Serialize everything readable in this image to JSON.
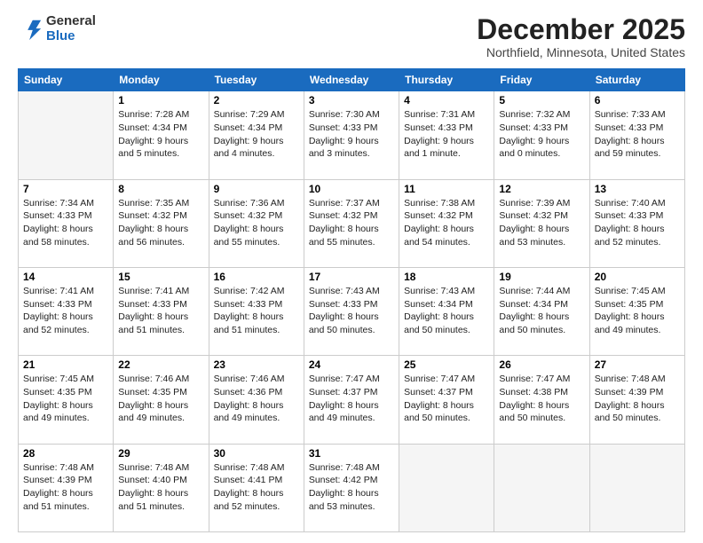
{
  "logo": {
    "line1": "General",
    "line2": "Blue"
  },
  "title": "December 2025",
  "location": "Northfield, Minnesota, United States",
  "days_header": [
    "Sunday",
    "Monday",
    "Tuesday",
    "Wednesday",
    "Thursday",
    "Friday",
    "Saturday"
  ],
  "weeks": [
    [
      {
        "num": "",
        "info": ""
      },
      {
        "num": "1",
        "info": "Sunrise: 7:28 AM\nSunset: 4:34 PM\nDaylight: 9 hours\nand 5 minutes."
      },
      {
        "num": "2",
        "info": "Sunrise: 7:29 AM\nSunset: 4:34 PM\nDaylight: 9 hours\nand 4 minutes."
      },
      {
        "num": "3",
        "info": "Sunrise: 7:30 AM\nSunset: 4:33 PM\nDaylight: 9 hours\nand 3 minutes."
      },
      {
        "num": "4",
        "info": "Sunrise: 7:31 AM\nSunset: 4:33 PM\nDaylight: 9 hours\nand 1 minute."
      },
      {
        "num": "5",
        "info": "Sunrise: 7:32 AM\nSunset: 4:33 PM\nDaylight: 9 hours\nand 0 minutes."
      },
      {
        "num": "6",
        "info": "Sunrise: 7:33 AM\nSunset: 4:33 PM\nDaylight: 8 hours\nand 59 minutes."
      }
    ],
    [
      {
        "num": "7",
        "info": "Sunrise: 7:34 AM\nSunset: 4:33 PM\nDaylight: 8 hours\nand 58 minutes."
      },
      {
        "num": "8",
        "info": "Sunrise: 7:35 AM\nSunset: 4:32 PM\nDaylight: 8 hours\nand 56 minutes."
      },
      {
        "num": "9",
        "info": "Sunrise: 7:36 AM\nSunset: 4:32 PM\nDaylight: 8 hours\nand 55 minutes."
      },
      {
        "num": "10",
        "info": "Sunrise: 7:37 AM\nSunset: 4:32 PM\nDaylight: 8 hours\nand 55 minutes."
      },
      {
        "num": "11",
        "info": "Sunrise: 7:38 AM\nSunset: 4:32 PM\nDaylight: 8 hours\nand 54 minutes."
      },
      {
        "num": "12",
        "info": "Sunrise: 7:39 AM\nSunset: 4:32 PM\nDaylight: 8 hours\nand 53 minutes."
      },
      {
        "num": "13",
        "info": "Sunrise: 7:40 AM\nSunset: 4:33 PM\nDaylight: 8 hours\nand 52 minutes."
      }
    ],
    [
      {
        "num": "14",
        "info": "Sunrise: 7:41 AM\nSunset: 4:33 PM\nDaylight: 8 hours\nand 52 minutes."
      },
      {
        "num": "15",
        "info": "Sunrise: 7:41 AM\nSunset: 4:33 PM\nDaylight: 8 hours\nand 51 minutes."
      },
      {
        "num": "16",
        "info": "Sunrise: 7:42 AM\nSunset: 4:33 PM\nDaylight: 8 hours\nand 51 minutes."
      },
      {
        "num": "17",
        "info": "Sunrise: 7:43 AM\nSunset: 4:33 PM\nDaylight: 8 hours\nand 50 minutes."
      },
      {
        "num": "18",
        "info": "Sunrise: 7:43 AM\nSunset: 4:34 PM\nDaylight: 8 hours\nand 50 minutes."
      },
      {
        "num": "19",
        "info": "Sunrise: 7:44 AM\nSunset: 4:34 PM\nDaylight: 8 hours\nand 50 minutes."
      },
      {
        "num": "20",
        "info": "Sunrise: 7:45 AM\nSunset: 4:35 PM\nDaylight: 8 hours\nand 49 minutes."
      }
    ],
    [
      {
        "num": "21",
        "info": "Sunrise: 7:45 AM\nSunset: 4:35 PM\nDaylight: 8 hours\nand 49 minutes."
      },
      {
        "num": "22",
        "info": "Sunrise: 7:46 AM\nSunset: 4:35 PM\nDaylight: 8 hours\nand 49 minutes."
      },
      {
        "num": "23",
        "info": "Sunrise: 7:46 AM\nSunset: 4:36 PM\nDaylight: 8 hours\nand 49 minutes."
      },
      {
        "num": "24",
        "info": "Sunrise: 7:47 AM\nSunset: 4:37 PM\nDaylight: 8 hours\nand 49 minutes."
      },
      {
        "num": "25",
        "info": "Sunrise: 7:47 AM\nSunset: 4:37 PM\nDaylight: 8 hours\nand 50 minutes."
      },
      {
        "num": "26",
        "info": "Sunrise: 7:47 AM\nSunset: 4:38 PM\nDaylight: 8 hours\nand 50 minutes."
      },
      {
        "num": "27",
        "info": "Sunrise: 7:48 AM\nSunset: 4:39 PM\nDaylight: 8 hours\nand 50 minutes."
      }
    ],
    [
      {
        "num": "28",
        "info": "Sunrise: 7:48 AM\nSunset: 4:39 PM\nDaylight: 8 hours\nand 51 minutes."
      },
      {
        "num": "29",
        "info": "Sunrise: 7:48 AM\nSunset: 4:40 PM\nDaylight: 8 hours\nand 51 minutes."
      },
      {
        "num": "30",
        "info": "Sunrise: 7:48 AM\nSunset: 4:41 PM\nDaylight: 8 hours\nand 52 minutes."
      },
      {
        "num": "31",
        "info": "Sunrise: 7:48 AM\nSunset: 4:42 PM\nDaylight: 8 hours\nand 53 minutes."
      },
      {
        "num": "",
        "info": ""
      },
      {
        "num": "",
        "info": ""
      },
      {
        "num": "",
        "info": ""
      }
    ]
  ]
}
